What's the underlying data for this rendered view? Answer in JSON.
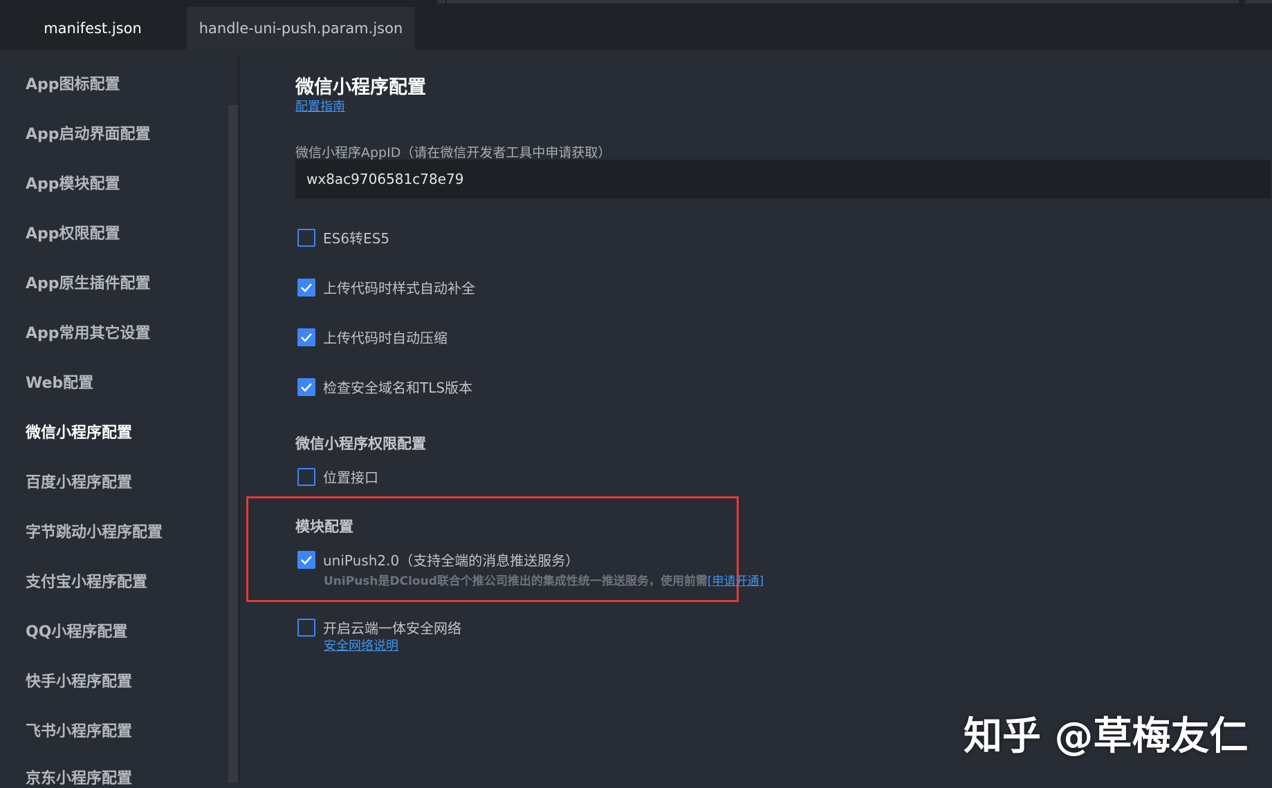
{
  "tabs": [
    {
      "label": "manifest.json",
      "active": true
    },
    {
      "label": "handle-uni-push.param.json",
      "active": false
    }
  ],
  "sidebar": {
    "items": [
      {
        "label": "App图标配置"
      },
      {
        "label": "App启动界面配置"
      },
      {
        "label": "App模块配置"
      },
      {
        "label": "App权限配置"
      },
      {
        "label": "App原生插件配置"
      },
      {
        "label": "App常用其它设置"
      },
      {
        "label": "Web配置"
      },
      {
        "label": "微信小程序配置",
        "active": true
      },
      {
        "label": "百度小程序配置"
      },
      {
        "label": "字节跳动小程序配置"
      },
      {
        "label": "支付宝小程序配置"
      },
      {
        "label": "QQ小程序配置"
      },
      {
        "label": "快手小程序配置"
      },
      {
        "label": "飞书小程序配置"
      },
      {
        "label": "京东小程序配置"
      }
    ]
  },
  "main": {
    "title": "微信小程序配置",
    "guide_link": "配置指南",
    "appid_label": "微信小程序AppID（请在微信开发者工具中申请获取）",
    "appid_value": "wx8ac9706581c78e79",
    "options": [
      {
        "label": "ES6转ES5",
        "checked": false
      },
      {
        "label": "上传代码时样式自动补全",
        "checked": true
      },
      {
        "label": "上传代码时自动压缩",
        "checked": true
      },
      {
        "label": "检查安全域名和TLS版本",
        "checked": true
      }
    ],
    "permission_section": {
      "title": "微信小程序权限配置",
      "option": {
        "label": "位置接口",
        "checked": false
      }
    },
    "module_section": {
      "title": "模块配置",
      "option": {
        "label": "uniPush2.0（支持全端的消息推送服务）",
        "checked": true
      },
      "description": "UniPush是DCloud联合个推公司推出的集成性统一推送服务，使用前需",
      "apply_link": "[申请开通]"
    },
    "secure_network": {
      "label": "开启云端一体安全网络",
      "checked": false,
      "link": "安全网络说明"
    }
  },
  "watermark": "知乎 @草梅友仁",
  "colors": {
    "accent": "#3d86f6",
    "link": "#3e95f1",
    "highlight": "#e8373b",
    "background": "#282c34"
  }
}
